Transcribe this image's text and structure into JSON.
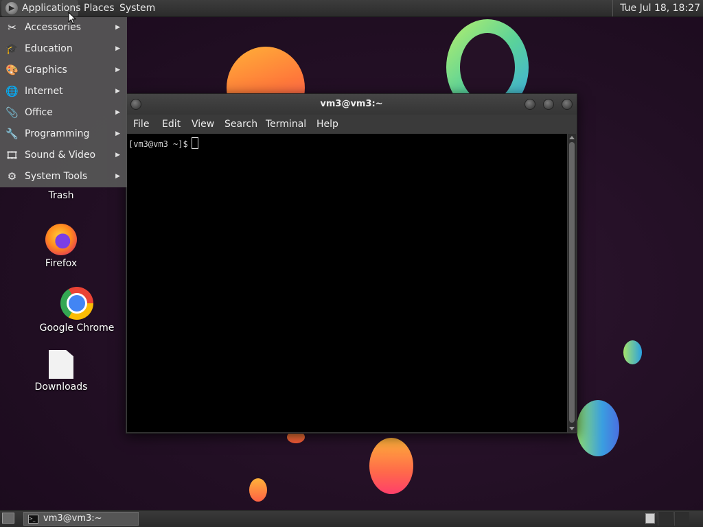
{
  "top_panel": {
    "menus": {
      "applications": "Applications",
      "places": "Places",
      "system": "System"
    },
    "clock": "Tue Jul 18, 18:27"
  },
  "apps_menu": {
    "items": [
      {
        "label": "Accessories",
        "icon": "accessories-icon"
      },
      {
        "label": "Education",
        "icon": "education-icon"
      },
      {
        "label": "Graphics",
        "icon": "graphics-icon"
      },
      {
        "label": "Internet",
        "icon": "internet-icon"
      },
      {
        "label": "Office",
        "icon": "office-icon"
      },
      {
        "label": "Programming",
        "icon": "programming-icon"
      },
      {
        "label": "Sound & Video",
        "icon": "sound-video-icon"
      },
      {
        "label": "System Tools",
        "icon": "system-tools-icon"
      }
    ]
  },
  "desktop_icons": {
    "trash": "Trash",
    "firefox": "Firefox",
    "chrome": "Google Chrome",
    "downloads": "Downloads"
  },
  "terminal": {
    "title": "vm3@vm3:~",
    "menu": {
      "file": "File",
      "edit": "Edit",
      "view": "View",
      "search": "Search",
      "terminal": "Terminal",
      "help": "Help"
    },
    "prompt": "[vm3@vm3 ~]$"
  },
  "bottom_panel": {
    "task_label": "vm3@vm3:~"
  },
  "colors": {
    "panel": "#2b2b2b",
    "menu_bg": "#565656",
    "desktop_bg": "#220f24",
    "terminal_bg": "#000000"
  }
}
